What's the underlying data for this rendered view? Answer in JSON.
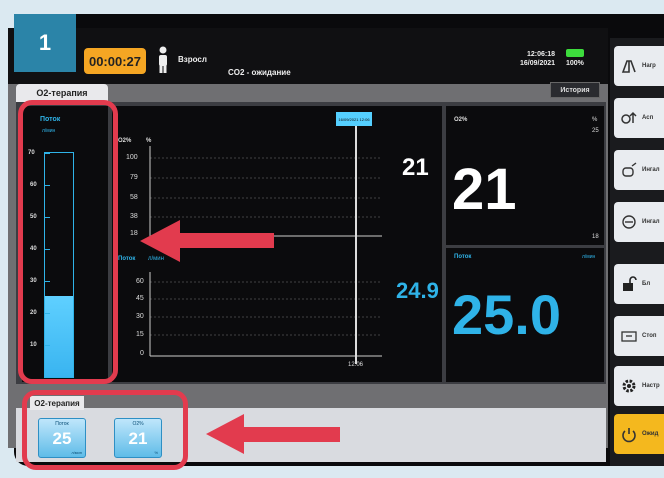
{
  "step_badge": "1",
  "topbar": {
    "timer": "00:00:27",
    "patient_name": "Взросл",
    "status_text": "CO2 - ожидание",
    "time": "12:06:18",
    "date": "16/09/2021",
    "battery": "100%"
  },
  "tabs": {
    "top_tab": "O2-терапия",
    "bottom_tab": "O2-терапия"
  },
  "history_button": "История",
  "flow_gauge": {
    "title": "Поток",
    "unit": "л/мин",
    "scale": [
      "70",
      "60",
      "50",
      "40",
      "30",
      "20",
      "10"
    ],
    "fill_fraction": 0.36
  },
  "graph": {
    "o2_title": "O2%",
    "o2_unit": "%",
    "o2_scale": [
      "100",
      "79",
      "58",
      "38",
      "18"
    ],
    "flow_title": "Поток",
    "flow_unit": "л/мин",
    "flow_scale": [
      "60",
      "45",
      "30",
      "15",
      "0"
    ],
    "o2_current": "21",
    "flow_current": "24.9",
    "cursor_label": "16/09/2021 12:06",
    "time_label": "12:06"
  },
  "right_panel": {
    "o2_title": "O2%",
    "o2_unit": "%",
    "o2_max": "25",
    "o2_min": "18",
    "o2_value": "21",
    "flow_title": "Поток",
    "flow_unit": "л/мин",
    "flow_value": "25.0"
  },
  "bottom_tiles": [
    {
      "title": "Поток",
      "value": "25",
      "unit": "л/мин"
    },
    {
      "title": "O2%",
      "value": "21",
      "unit": "%"
    }
  ],
  "sidebar": {
    "buttons": [
      {
        "label": "Нагр",
        "icon": "lung-icon"
      },
      {
        "label": "Асп",
        "icon": "o2-arrow-icon"
      },
      {
        "label": "Ингал",
        "icon": "nebulizer-icon"
      },
      {
        "label": "Ингал",
        "icon": "filter-icon"
      },
      {
        "label": "Бл",
        "icon": "unlock-icon"
      },
      {
        "label": "Стоп",
        "icon": "stop-screen-icon"
      },
      {
        "label": "Настр",
        "icon": "gear-icon"
      },
      {
        "label": "Ожид",
        "icon": "power-icon"
      }
    ]
  },
  "colors": {
    "accent_blue": "#2fb3e8",
    "annotation_red": "#e23b4e",
    "timer_orange": "#f5a623",
    "badge_teal": "#2b84a8"
  }
}
